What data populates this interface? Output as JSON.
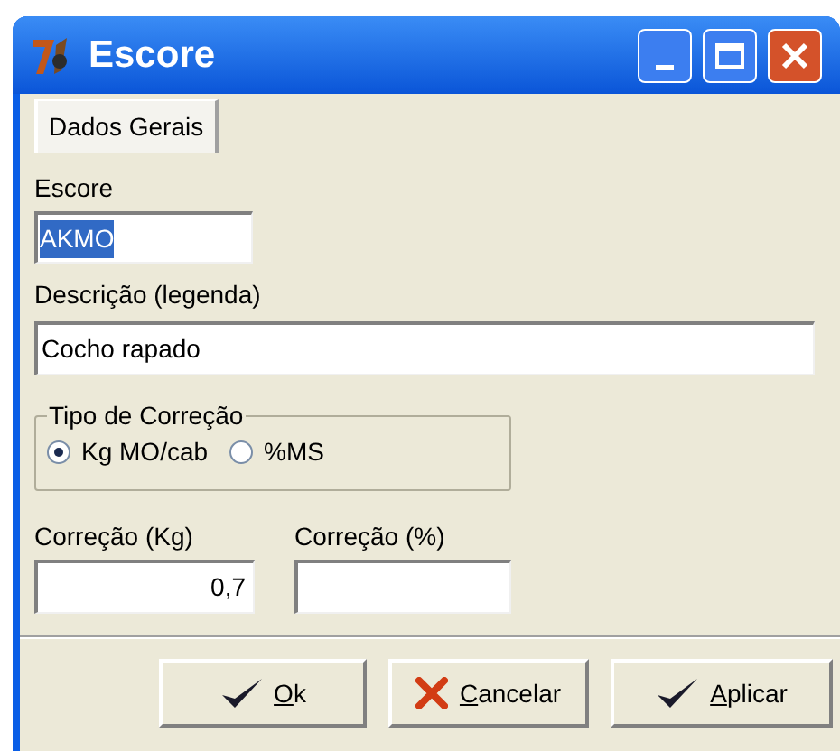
{
  "window": {
    "title": "Escore"
  },
  "tabs": [
    {
      "label": "Dados Gerais",
      "selected": true
    }
  ],
  "escore": {
    "label": "Escore",
    "value": "AKMO",
    "highlighted": true
  },
  "descricao": {
    "label": "Descrição (legenda)",
    "value": "Cocho rapado"
  },
  "tipo_de_correcao": {
    "title": "Tipo de Correção",
    "options": [
      {
        "label": "Kg MO/cab",
        "selected": true
      },
      {
        "label": "%MS",
        "selected": false
      }
    ]
  },
  "correcao_kg": {
    "label": "Correção (Kg)",
    "value": "0,7"
  },
  "correcao_pct": {
    "label": "Correção (%)"
  },
  "buttons": [
    {
      "label": "Ok",
      "kind": "check"
    },
    {
      "label": "Cancelar",
      "kind": "cross"
    },
    {
      "label": "Aplicar",
      "kind": "check"
    }
  ]
}
